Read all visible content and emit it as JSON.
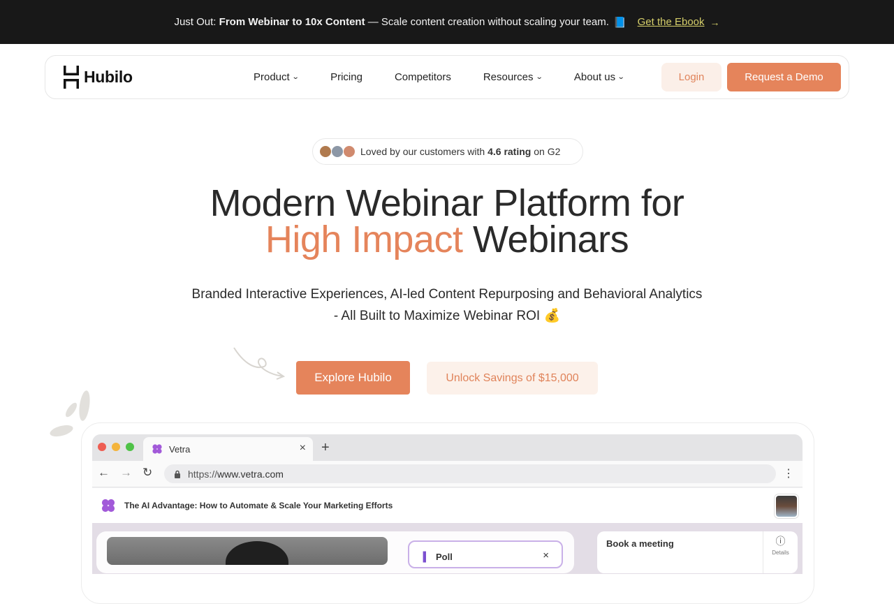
{
  "announcement": {
    "prefix": "Just Out:",
    "highlight": "From Webinar to 10x Content",
    "text": "— Scale content creation without scaling your team.",
    "book_icon": "📘",
    "cta": "Get the Ebook",
    "arrow_icon": "→"
  },
  "nav": {
    "logo_text": "Hubilo",
    "items": [
      {
        "label": "Product",
        "has_dropdown": true
      },
      {
        "label": "Pricing",
        "has_dropdown": false
      },
      {
        "label": "Competitors",
        "has_dropdown": false
      },
      {
        "label": "Resources",
        "has_dropdown": true
      },
      {
        "label": "About us",
        "has_dropdown": true
      }
    ],
    "chevron": "⌄",
    "login": "Login",
    "demo": "Request a Demo"
  },
  "rating": {
    "text_before": "Loved by our customers with",
    "rating": "4.6 rating",
    "text_after": "on G2"
  },
  "hero": {
    "line1": "Modern Webinar Platform for",
    "line2_accent": "High Impact",
    "line2_rest": "Webinars",
    "sub1": "Branded Interactive Experiences, AI-led Content Repurposing and Behavioral Analytics",
    "sub2": "- All Built to Maximize Webinar ROI 💰",
    "explore": "Explore Hubilo",
    "savings": "Unlock Savings of $15,000"
  },
  "browser": {
    "tab_title": "Vetra",
    "tab_close": "×",
    "new_tab": "+",
    "back": "←",
    "forward": "→",
    "reload": "↻",
    "url_scheme": "https://",
    "url_host": "www.vetra.com",
    "menu": "⋮",
    "app_title": "The AI Advantage: How to Automate & Scale Your Marketing Efforts",
    "poll_label": "Poll",
    "poll_close": "×",
    "book_meeting": "Book a meeting",
    "details": "Details",
    "info_icon": "ⓘ"
  },
  "colors": {
    "accent": "#e5845b",
    "accent_soft": "#fbefe8",
    "announce_bg": "#181818",
    "link_yellow": "#d6cf6a"
  }
}
